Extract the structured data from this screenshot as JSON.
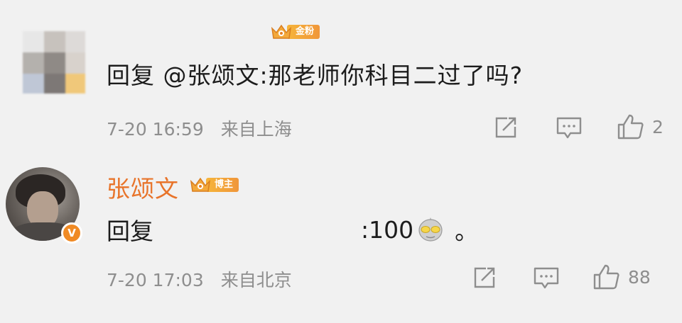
{
  "comments": [
    {
      "badge": "金粉",
      "text": {
        "reply_word": "回复",
        "mention": "@张颂文",
        "body": ":那老师你科目二过了吗?"
      },
      "time": "7-20 16:59",
      "location": "来自上海",
      "likes": "2",
      "icons": [
        "share-icon",
        "comment-icon",
        "like-icon"
      ]
    },
    {
      "username": "张颂文",
      "badge": "博主",
      "verified": "V",
      "text": {
        "reply_word": "回复",
        "body": ":100",
        "suffix": "。"
      },
      "time": "7-20 17:03",
      "location": "来自北京",
      "likes": "88",
      "icons": [
        "share-icon",
        "comment-icon",
        "like-icon"
      ]
    }
  ],
  "colors": {
    "background": "#f1f1f1",
    "username": "#e8742a",
    "meta": "#8e8e8e",
    "badge": "#f0963a"
  }
}
